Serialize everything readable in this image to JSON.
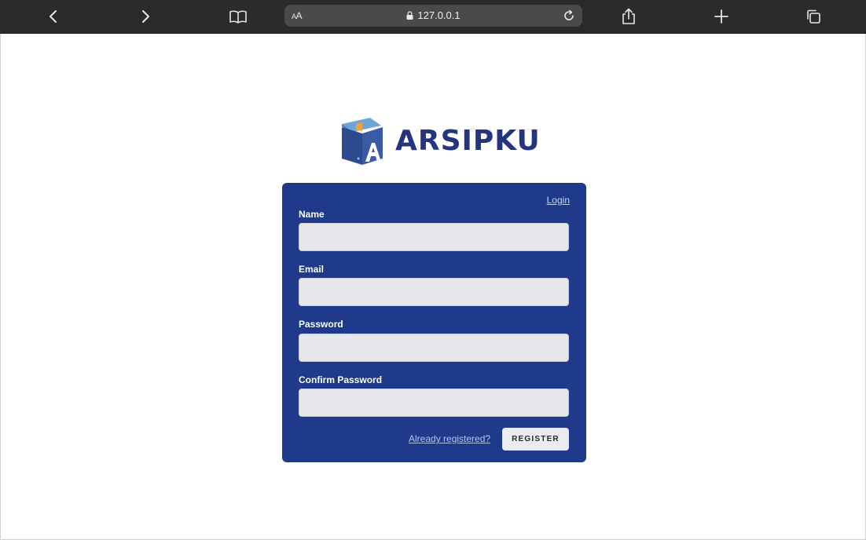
{
  "browser": {
    "text_size_small": "A",
    "text_size_large": "A",
    "url": "127.0.0.1",
    "icons": [
      "back-icon",
      "forward-icon",
      "bookmarks-icon",
      "lock-icon",
      "reload-icon",
      "share-icon",
      "new-tab-icon",
      "tabs-icon"
    ]
  },
  "brand": {
    "name": "ARSIPKU",
    "color": "#24357d"
  },
  "form": {
    "login_link": "Login",
    "fields": [
      {
        "label": "Name",
        "value": "",
        "placeholder": ""
      },
      {
        "label": "Email",
        "value": "",
        "placeholder": ""
      },
      {
        "label": "Password",
        "value": "",
        "placeholder": ""
      },
      {
        "label": "Confirm Password",
        "value": "",
        "placeholder": ""
      }
    ],
    "already_registered": "Already registered?",
    "register_button": "REGISTER",
    "card_color": "#1f3a8a"
  }
}
